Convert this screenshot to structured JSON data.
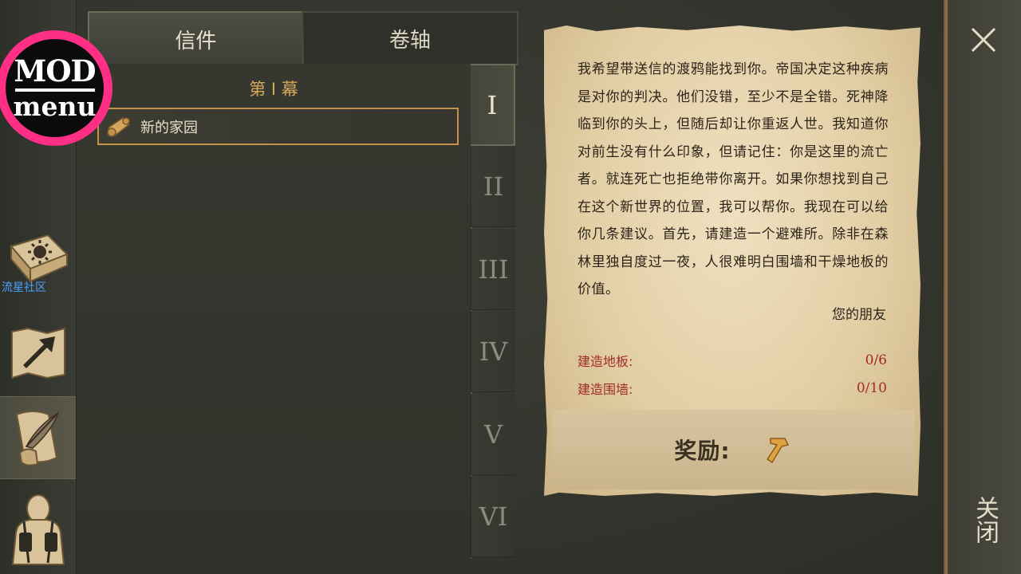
{
  "mod_badge": {
    "line1": "MOD",
    "line2": "menu"
  },
  "watermark": "流星社区",
  "tabs": {
    "letters": "信件",
    "scrolls": "卷轴"
  },
  "act_title": "第 I 幕",
  "quest": {
    "title": "新的家园"
  },
  "chapters": [
    "I",
    "II",
    "III",
    "IV",
    "V",
    "VI"
  ],
  "letter": {
    "body": "我希望带送信的渡鸦能找到你。帝国决定这种疾病是对你的判决。他们没错，至少不是全错。死神降临到你的头上，但随后却让你重返人世。我知道你对前生没有什么印象，但请记住：你是这里的流亡者。就连死亡也拒绝带你离开。如果你想找到自己在这个新世界的位置，我可以帮你。我现在可以给你几条建议。首先，请建造一个避难所。除非在森林里独自度过一夜，人很难明白围墙和干燥地板的价值。",
    "signature": "您的朋友",
    "tasks": [
      {
        "label": "建造地板:",
        "progress": "0/6"
      },
      {
        "label": "建造围墙:",
        "progress": "0/10"
      }
    ],
    "reward_label": "奖励:"
  },
  "close": {
    "label": "关闭"
  },
  "colors": {
    "accent_gold": "#c49249",
    "task_red": "#a02b2b",
    "paper": "#e3cfa6",
    "mod_pink": "#ff2f86"
  }
}
